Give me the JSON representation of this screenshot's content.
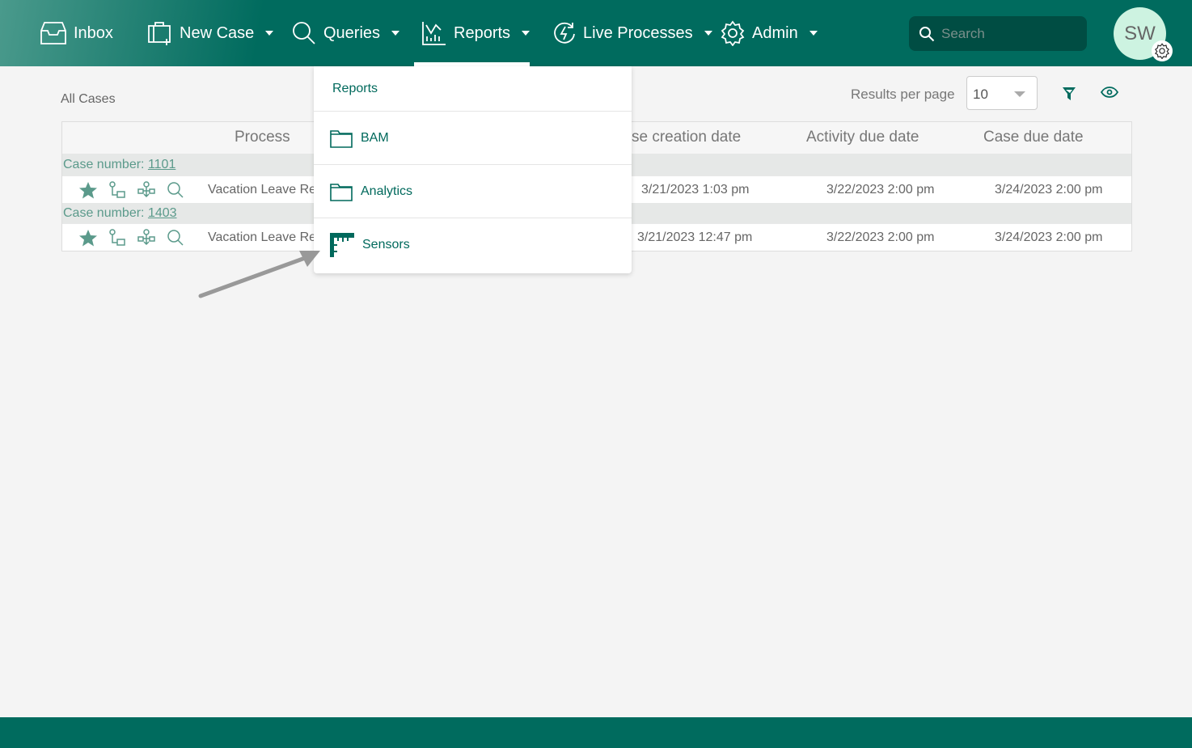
{
  "nav": {
    "inbox": "Inbox",
    "new_case": "New Case",
    "queries": "Queries",
    "reports": "Reports",
    "live_processes": "Live Processes",
    "admin": "Admin"
  },
  "search": {
    "placeholder": "Search"
  },
  "user": {
    "initials": "SW"
  },
  "page": {
    "title": "All Cases",
    "results_per_page_label": "Results per page",
    "results_per_page": "10"
  },
  "table": {
    "headers": [
      "Process",
      "se creation date",
      "Activity due date",
      "Case due date"
    ],
    "groups": [
      {
        "label": "Case number: ",
        "number": "1101",
        "process": "Vacation Leave Re",
        "created": "3/21/2023 1:03 pm",
        "activity_due": "3/22/2023 2:00 pm",
        "case_due": "3/24/2023 2:00 pm"
      },
      {
        "label": "Case number: ",
        "number": "1403",
        "process": "Vacation Leave Re",
        "created": "3/21/2023 12:47 pm",
        "activity_due": "3/22/2023 2:00 pm",
        "case_due": "3/24/2023 2:00 pm"
      }
    ]
  },
  "reports_menu": {
    "header": "Reports",
    "items": [
      {
        "label": "BAM",
        "icon": "folder-icon"
      },
      {
        "label": "Analytics",
        "icon": "folder-icon"
      },
      {
        "label": "Sensors",
        "icon": "sensor-icon"
      }
    ]
  },
  "colors": {
    "brand": "#006b5e",
    "accent": "#5b9a8b"
  }
}
